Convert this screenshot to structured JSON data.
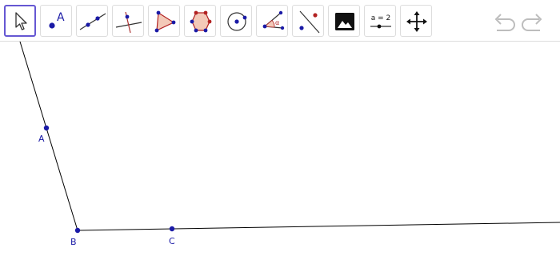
{
  "toolbar": {
    "tools": [
      {
        "name": "move-tool",
        "icon": "cursor-arrow-icon",
        "active": true
      },
      {
        "name": "point-tool",
        "icon": "point-icon",
        "label": "A"
      },
      {
        "name": "line-tool",
        "icon": "line-through-two-points-icon"
      },
      {
        "name": "perpendicular-line-tool",
        "icon": "perpendicular-line-icon"
      },
      {
        "name": "polygon-tool",
        "icon": "polygon-icon"
      },
      {
        "name": "regular-polygon-tool",
        "icon": "pentagon-icon"
      },
      {
        "name": "circle-tool",
        "icon": "circle-with-center-icon"
      },
      {
        "name": "angle-tool",
        "icon": "angle-icon",
        "label": "α"
      },
      {
        "name": "reflect-tool",
        "icon": "reflect-about-line-icon"
      },
      {
        "name": "image-tool",
        "icon": "image-icon"
      },
      {
        "name": "slider-tool",
        "icon": "slider-icon",
        "label": "a = 2"
      },
      {
        "name": "move-graphics-view-tool",
        "icon": "move-arrows-icon"
      }
    ],
    "undo": {
      "icon": "undo-icon"
    },
    "redo": {
      "icon": "redo-icon"
    }
  },
  "canvas": {
    "points": [
      {
        "label": "A"
      },
      {
        "label": "B"
      },
      {
        "label": "C"
      }
    ]
  },
  "colors": {
    "accent": "#6557d2",
    "point": "#1a1aa6",
    "line": "#000000",
    "polygon_fill": "#f3c9b8",
    "polygon_stroke": "#b22222",
    "icon_disabled": "#bdbdbd"
  }
}
